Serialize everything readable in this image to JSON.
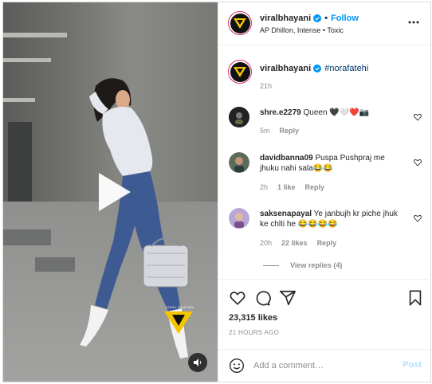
{
  "post": {
    "username": "viralbhayani",
    "follow_label": "Follow",
    "dot": "•",
    "audio_artist": "AP Dhillon, Intense",
    "audio_track": "Toxic",
    "audio_separator": "•"
  },
  "caption": {
    "username": "viralbhayani",
    "hashtag": "#norafatehi",
    "time": "21h"
  },
  "comments": [
    {
      "username": "shre.e2279",
      "text": "Queen 🖤️🤍❤️📷",
      "time": "5m",
      "likes": "",
      "reply_label": "Reply"
    },
    {
      "username": "davidbanna09",
      "text": "Puspa Pushpraj me jhuku nahi sala😂😂",
      "time": "2h",
      "likes": "1 like",
      "reply_label": "Reply"
    },
    {
      "username": "saksenapayal",
      "text": "Ye janbujh kr piche jhuk ke chlti he 😂😂😂😂",
      "time": "20h",
      "likes": "22 likes",
      "reply_label": "Reply"
    }
  ],
  "view_replies_label": "View replies (4)",
  "actions": {
    "likes_count": "23,315 likes",
    "posted_time": "21 HOURS AGO"
  },
  "add_comment": {
    "placeholder": "Add a comment…",
    "post_label": "Post"
  },
  "media": {
    "watermark_text": "VIRAL BHAYANI"
  },
  "colors": {
    "accent_blue": "#0095f6",
    "post_disabled": "#b2dffc",
    "hashtag": "#00376b",
    "secondary_text": "#8e8e8e",
    "brand_yellow": "#f5c400"
  }
}
